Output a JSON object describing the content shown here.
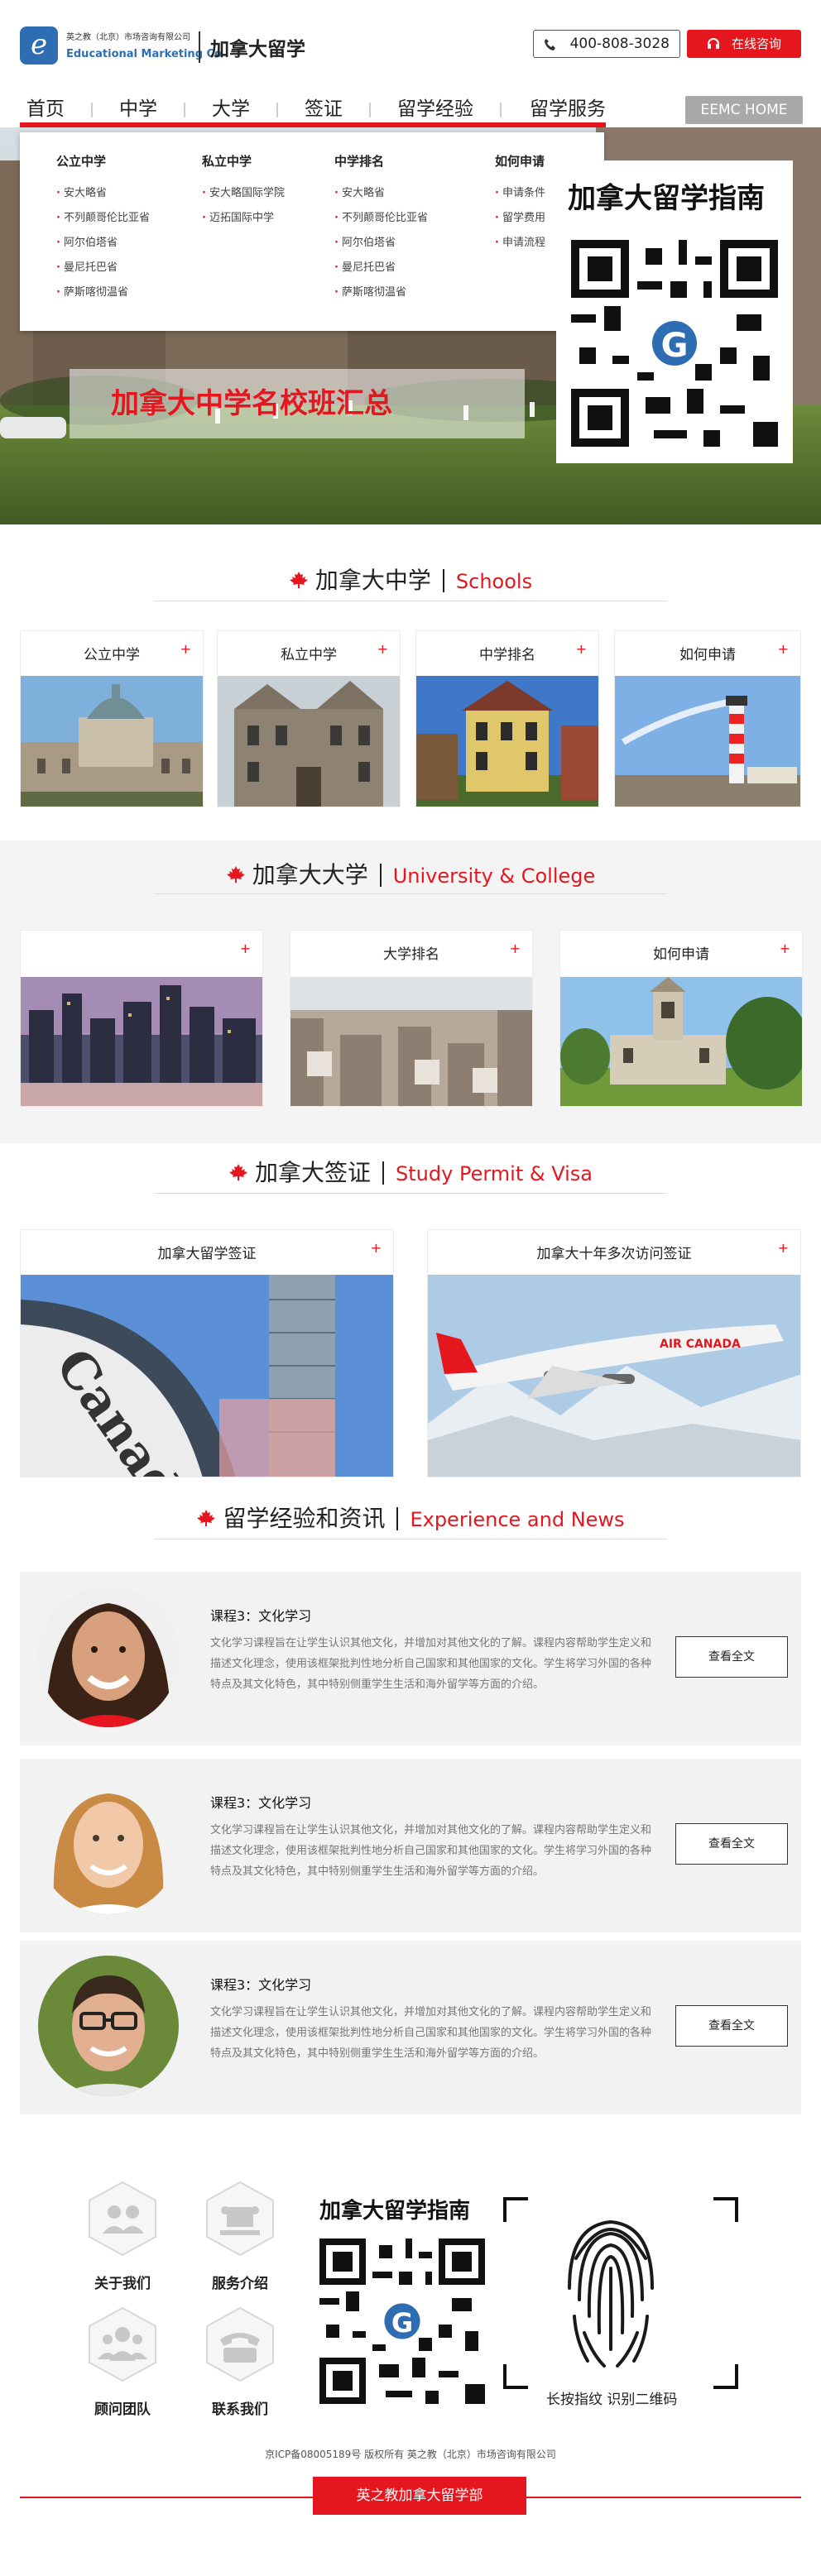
{
  "header": {
    "logo_glyph": "e",
    "logo_cn": "英之教（北京）市场咨询有限公司",
    "logo_en": "Educational Marketing Co",
    "site_title": "加拿大留学",
    "phone": "400-808-3028",
    "consult_label": "在线咨询",
    "accent_color": "#e6161e",
    "logo_color": "#2f6db3"
  },
  "nav": {
    "items": [
      "首页",
      "中学",
      "大学",
      "签证",
      "留学经验",
      "留学服务"
    ],
    "active_index": 0,
    "eemc_label": "EEMC HOME"
  },
  "dropdown": {
    "columns": [
      {
        "title": "公立中学",
        "links": [
          "安大略省",
          "不列颠哥伦比亚省",
          "阿尔伯塔省",
          "曼尼托巴省",
          "萨斯喀彻温省"
        ]
      },
      {
        "title": "私立中学",
        "links": [
          "安大略国际学院",
          "迈拓国际中学"
        ]
      },
      {
        "title": "中学排名",
        "links": [
          "安大略省",
          "不列颠哥伦比亚省",
          "阿尔伯塔省",
          "曼尼托巴省",
          "萨斯喀彻温省"
        ]
      },
      {
        "title": "如何申请",
        "links": [
          "申请条件",
          "留学费用",
          "申请流程"
        ]
      }
    ]
  },
  "hero": {
    "banner_text": "加拿大中学名校班汇总",
    "qr_title": "加拿大留学指南"
  },
  "schools": {
    "title_cn": "加拿大中学",
    "title_en": "Schools",
    "cards": [
      "公立中学",
      "私立中学",
      "中学排名",
      "如何申请"
    ]
  },
  "university": {
    "title_cn": "加拿大大学",
    "title_en": "University & College",
    "cards": [
      "",
      "大学排名",
      "如何申请"
    ]
  },
  "visa": {
    "title_cn": "加拿大签证",
    "title_en": "Study Permit & Visa",
    "cards": [
      "加拿大留学签证",
      "加拿大十年多次访问签证"
    ]
  },
  "news": {
    "title_cn": "留学经验和资讯",
    "title_en": "Experience and News",
    "items": [
      {
        "title": "课程3：文化学习",
        "desc": "文化学习课程旨在让学生认识其他文化，并增加对其他文化的了解。课程内容帮助学生定义和描述文化理念，使用该框架批判性地分析自己国家和其他国家的文化。学生将学习外国的各种特点及其文化特色，其中特别侧重学生生活和海外留学等方面的介绍。",
        "button": "查看全文"
      },
      {
        "title": "课程3：文化学习",
        "desc": "文化学习课程旨在让学生认识其他文化，并增加对其他文化的了解。课程内容帮助学生定义和描述文化理念，使用该框架批判性地分析自己国家和其他国家的文化。学生将学习外国的各种特点及其文化特色，其中特别侧重学生生活和海外留学等方面的介绍。",
        "button": "查看全文"
      },
      {
        "title": "课程3：文化学习",
        "desc": "文化学习课程旨在让学生认识其他文化，并增加对其他文化的了解。课程内容帮助学生定义和描述文化理念，使用该框架批判性地分析自己国家和其他国家的文化。学生将学习外国的各种特点及其文化特色，其中特别侧重学生生活和海外留学等方面的介绍。",
        "button": "查看全文"
      }
    ]
  },
  "footer": {
    "links": [
      "关于我们",
      "服务介绍",
      "顾问团队",
      "联系我们"
    ],
    "qr_title": "加拿大留学指南",
    "fingerprint_label": "长按指纹 识别二维码",
    "icp": "京ICP备08005189号 版权所有 英之教（北京）市场咨询有限公司",
    "bottom_button": "英之教加拿大留学部"
  }
}
